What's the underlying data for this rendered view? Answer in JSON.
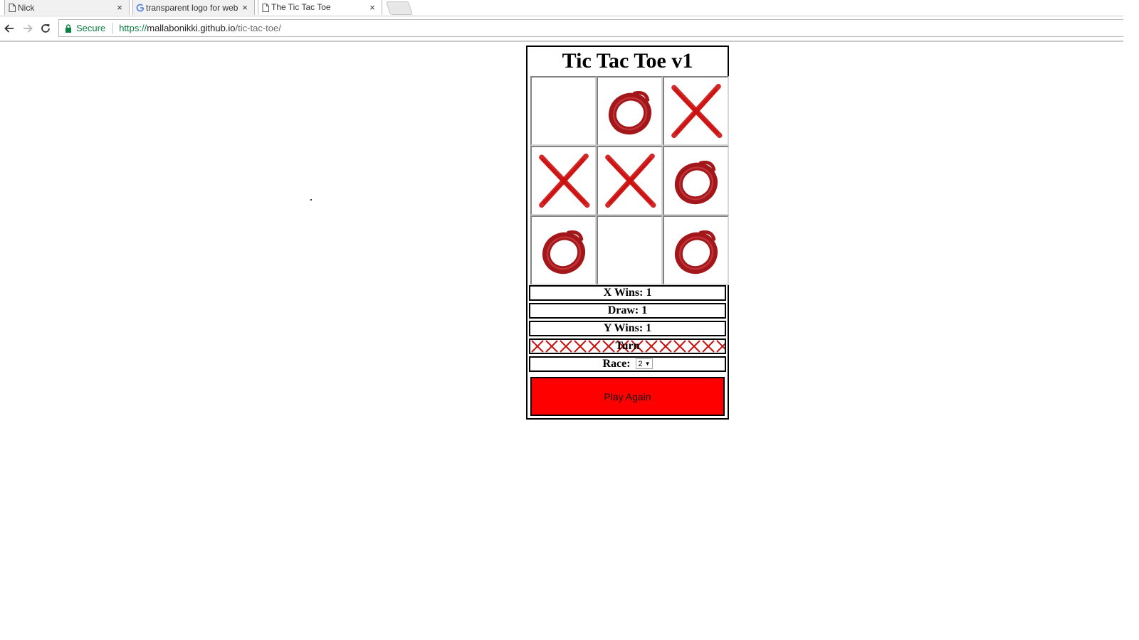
{
  "browser": {
    "tabs": [
      {
        "label": "Nick",
        "icon": "page-icon",
        "active": false
      },
      {
        "label": "transparent logo for web",
        "icon": "google-icon",
        "active": false
      },
      {
        "label": "The Tic Tac Toe",
        "icon": "page-icon",
        "active": true
      }
    ],
    "tab_close_glyph": "×",
    "secure_label": "Secure",
    "url": {
      "scheme": "https://",
      "host": "mallabonikki.github.io",
      "path": "/tic-tac-toe/"
    }
  },
  "game": {
    "title": "Tic Tac Toe v1",
    "board": [
      "",
      "O",
      "X",
      "X",
      "X",
      "O",
      "O",
      "",
      "O"
    ],
    "x_wins": "X Wins: 1",
    "draw": "Draw: 1",
    "y_wins": "Y Wins: 1",
    "turn_label": "Turn",
    "race_label": "Race:",
    "race_value": "2",
    "play_again_label": "Play Again",
    "mark_color": "#cc1111",
    "o_color": "#a3161a",
    "button_color": "#ff0000"
  }
}
